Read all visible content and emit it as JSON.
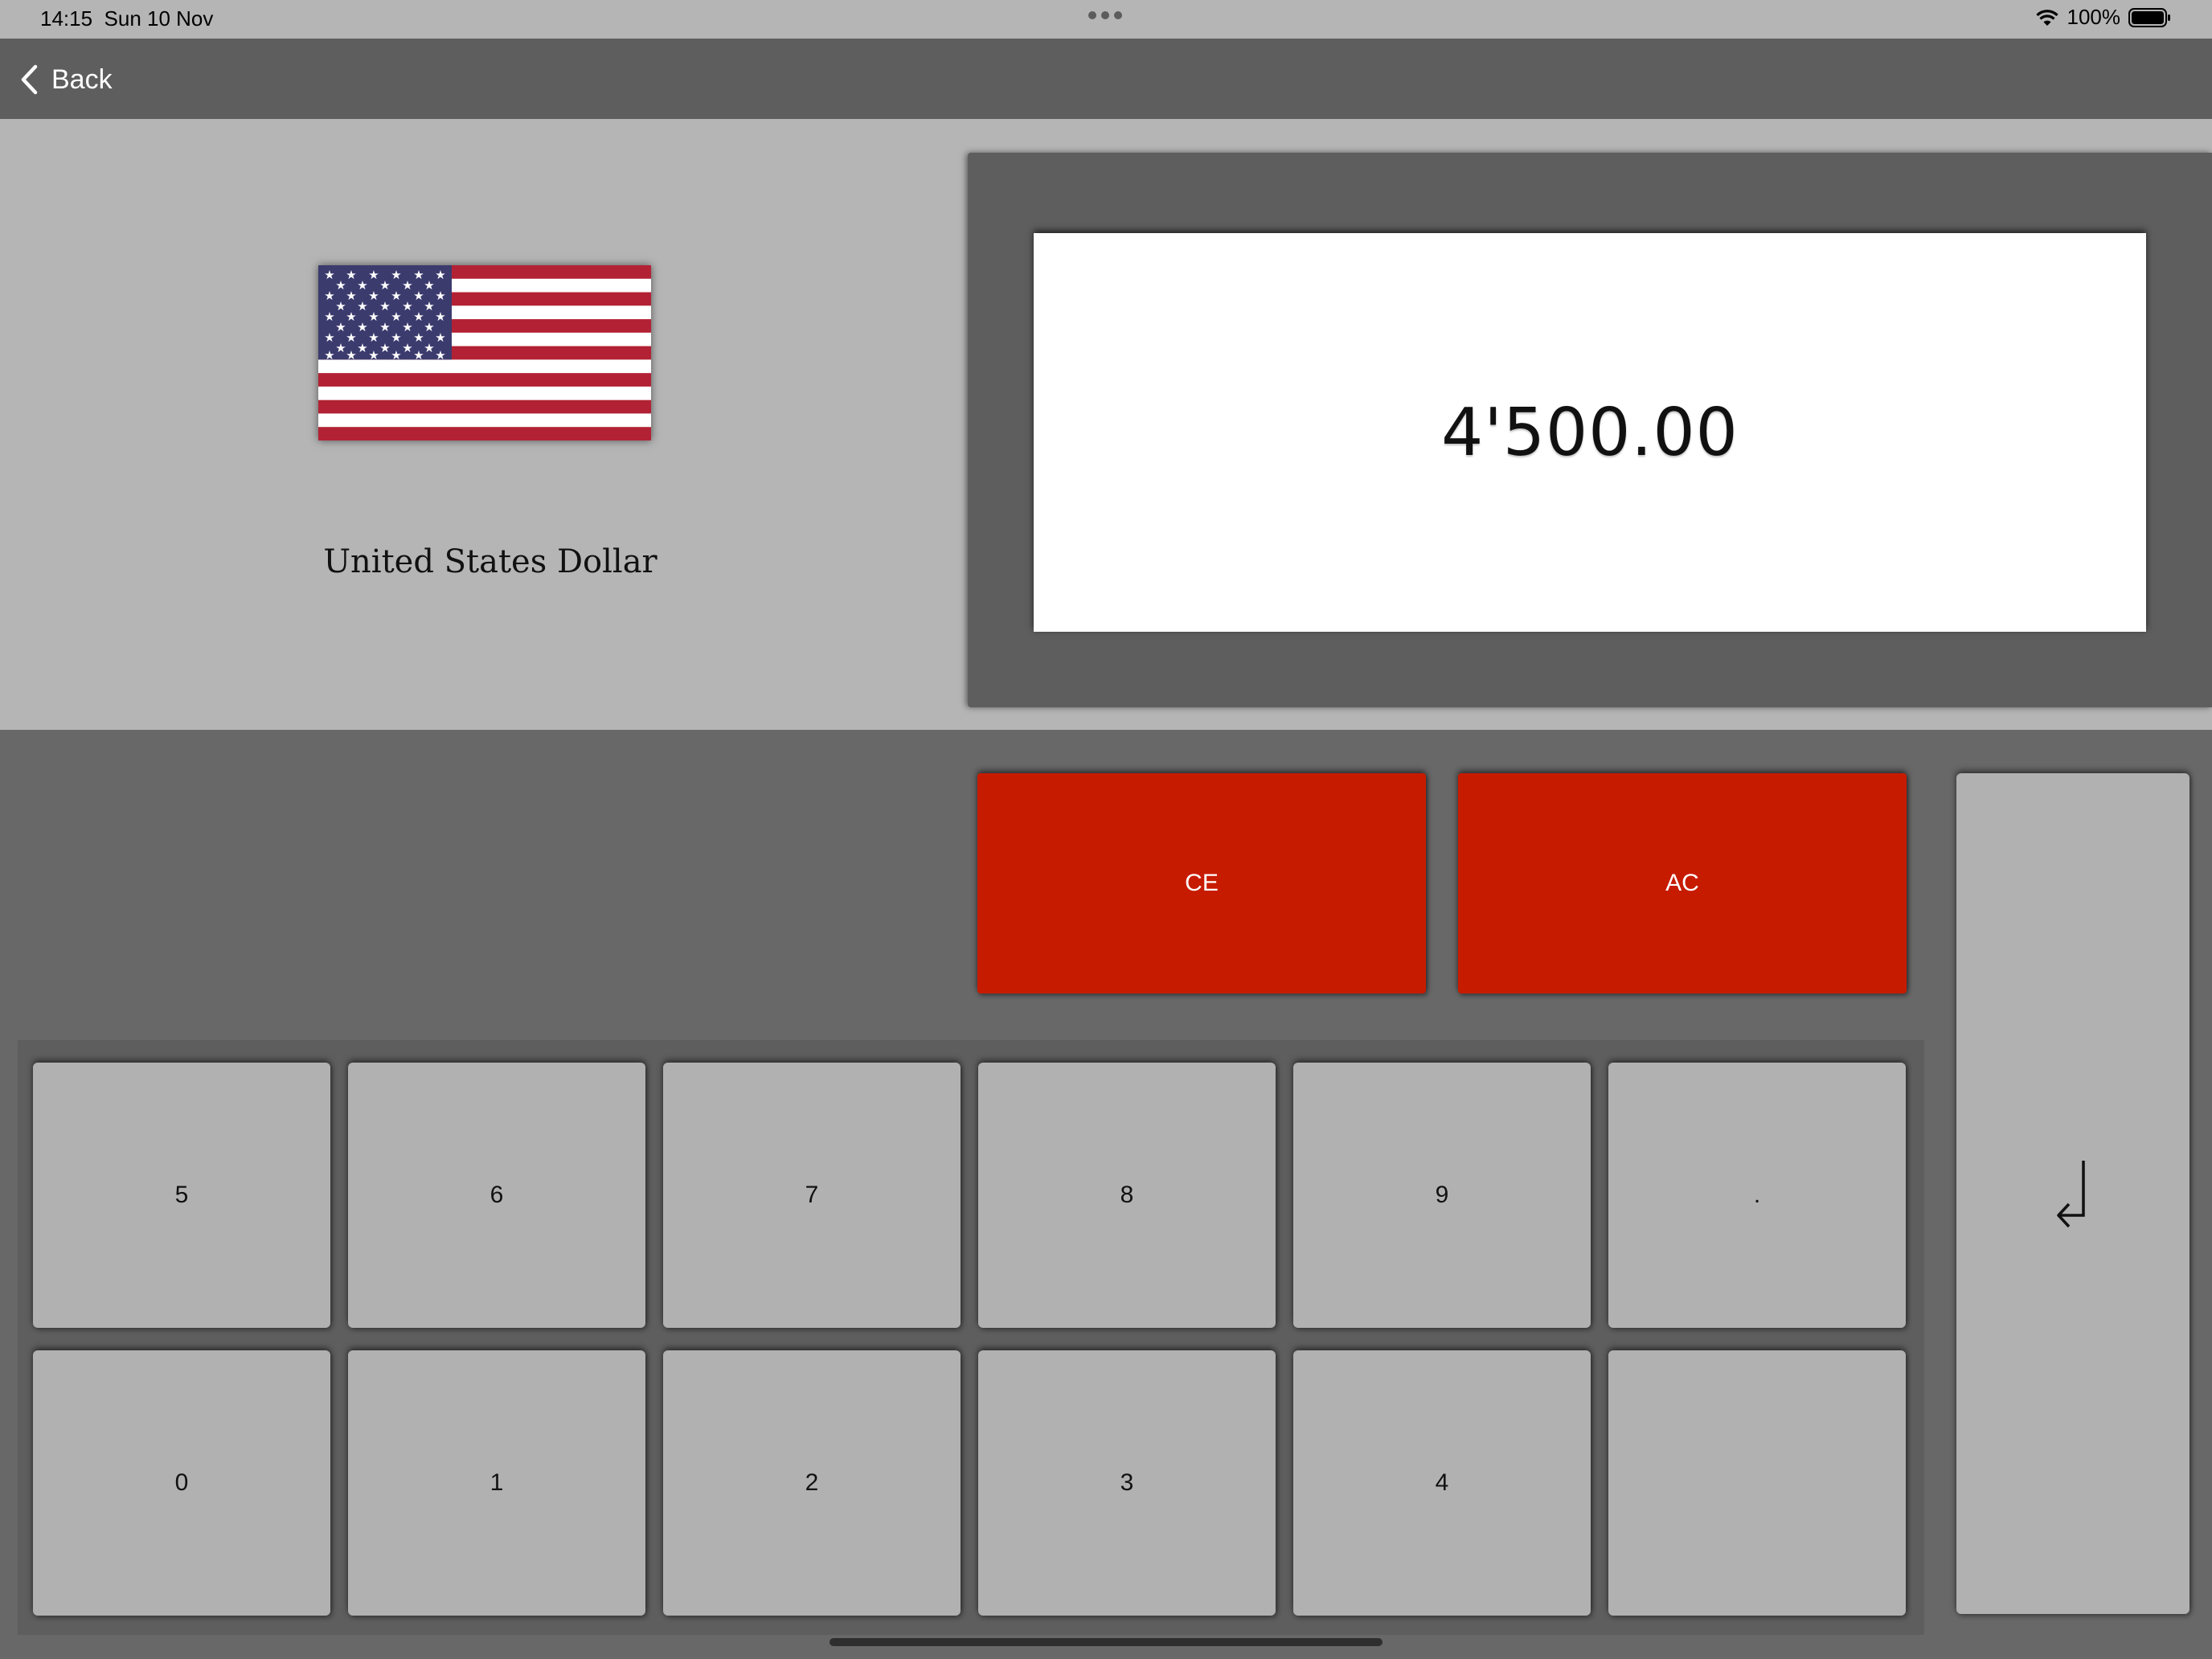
{
  "status_bar": {
    "time": "14:15",
    "date": "Sun 10 Nov",
    "battery": "100%"
  },
  "nav": {
    "back_label": "Back"
  },
  "currency": {
    "name": "United States Dollar",
    "flag_icon": "us-flag-icon"
  },
  "display": {
    "value": "4'500.00"
  },
  "keys": {
    "ce": "CE",
    "ac": "AC",
    "row1": [
      "5",
      "6",
      "7",
      "8",
      "9",
      "."
    ],
    "row2": [
      "0",
      "1",
      "2",
      "3",
      "4",
      ""
    ],
    "enter_icon": "return-arrow-icon"
  },
  "colors": {
    "accent_red": "#c71b00",
    "key_gray": "#b1b1b1",
    "frame_gray": "#5e5e5e"
  }
}
